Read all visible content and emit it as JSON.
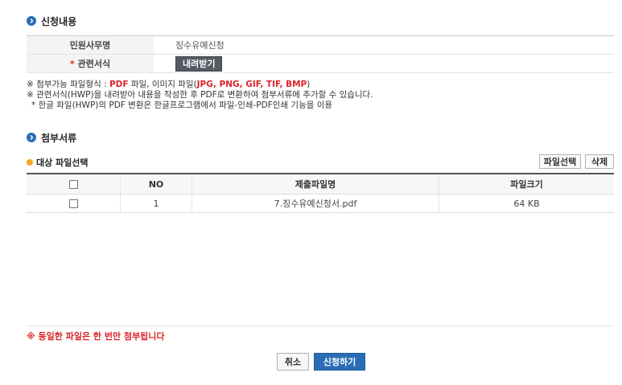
{
  "application": {
    "section_title": "신청내용",
    "rows": [
      {
        "label": "민원사무명",
        "value": "징수유예신청"
      },
      {
        "label": "관련서식",
        "required_mark": "*",
        "button": "내려받기"
      }
    ]
  },
  "notes": {
    "line1_prefix": "※ 첨부가능 파일형식 : ",
    "line1_pdf": "PDF",
    "line1_mid": " 파일, 이미지 파일(",
    "line1_images": "JPG, PNG, GIF, TIF, BMP",
    "line1_suffix": ")",
    "line2": "※ 관련서식(HWP)을 내려받아 내용을 작성한 후 PDF로 변환하여 첨부서류에 추가할 수 있습니다.",
    "line3": "* 한글 파일(HWP)의 PDF 변환은 한글프로그램에서 파일-인쇄-PDF인쇄 기능을 이용"
  },
  "attachments": {
    "section_title": "첨부서류",
    "subhead": "대상 파일선택",
    "select_button": "파일선택",
    "delete_button": "삭제",
    "columns": [
      "NO",
      "제출파일명",
      "파일크기"
    ],
    "rows": [
      {
        "no": "1",
        "filename": "7.징수유예신청서.pdf",
        "size": "64 KB"
      }
    ]
  },
  "warning": "※ 동일한 파일은 한 번만 첨부됩니다",
  "footer": {
    "cancel": "취소",
    "submit": "신청하기"
  },
  "colors": {
    "accent": "#2a6db5",
    "alert": "#d9252a",
    "bullet_orange": "#f5a623"
  }
}
